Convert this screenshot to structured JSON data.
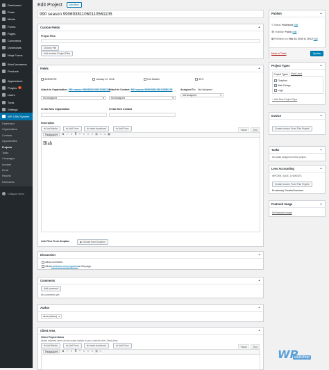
{
  "sidebar": {
    "items": [
      {
        "label": "Dashboard",
        "icon": "dashboard-icon"
      },
      {
        "label": "Posts",
        "icon": "pin-icon"
      },
      {
        "label": "Media",
        "icon": "media-icon"
      },
      {
        "label": "Forms",
        "icon": "forms-icon"
      },
      {
        "label": "Pages",
        "icon": "pages-icon"
      },
      {
        "label": "Comments",
        "icon": "comments-icon"
      },
      {
        "label": "Downloads",
        "icon": "download-icon"
      },
      {
        "label": "Ninja Forms",
        "icon": "ninja-forms-icon"
      },
      {
        "label": "WooCommerce",
        "icon": "woocommerce-icon"
      },
      {
        "label": "Products",
        "icon": "products-icon"
      },
      {
        "label": "Appearance",
        "icon": "appearance-icon"
      },
      {
        "label": "Plugins",
        "icon": "plugins-icon",
        "badge": "1"
      },
      {
        "label": "Users",
        "icon": "users-icon"
      },
      {
        "label": "Tools",
        "icon": "tools-icon"
      },
      {
        "label": "Settings",
        "icon": "settings-icon"
      },
      {
        "label": "WP-CRM System",
        "icon": "crm-icon"
      }
    ],
    "submenu": [
      "Dashboard",
      "Organizations",
      "Contacts",
      "Opportunities",
      "Projects",
      "Tasks",
      "Campaigns",
      "Invoices",
      "Email",
      "Reports",
      "Extensions"
    ],
    "collapse": "Collapse menu"
  },
  "header": {
    "title": "Edit Project",
    "add_new": "Add New"
  },
  "post_title": "990 season 990693811060110561105",
  "custom_fields": {
    "heading": "Custom Fields",
    "project_files_label": "Project Files",
    "choose_file": "Choose File",
    "add_another": "Add another Project Files"
  },
  "fields": {
    "heading": "Fields",
    "value": "843906799",
    "date": "January 12, 2018",
    "status": "Not Started",
    "progress": "40%",
    "attach_org_label": "Attach to Organization:",
    "attach_org_link": "990 season 990693811060110561105",
    "attach_contact_label": "Attach to Contact:",
    "attach_contact_link": "990 season 990693811060110561105",
    "assigned_label": "Assigned To:",
    "assigned_value": "Not Assigned",
    "select_org": "Not Assigned",
    "select_contact": "Not Assigned",
    "assigned_select": "Not Assigned",
    "create_org": "Create New Organization",
    "create_contact": "Create New Contact",
    "description": "Description",
    "add_media": "Add Media",
    "add_form": "Add Form",
    "insert_download": "Insert download",
    "add_form2": "Add Form",
    "visual": "Visual",
    "text": "Text",
    "paragraph": "Paragraph",
    "content": "Blah",
    "link_files": "Link Files From Dropbox",
    "choose_dropbox": "Choose from Dropbox"
  },
  "discussion": {
    "heading": "Discussion",
    "allow_comments": "Allow comments.",
    "allow_trackbacks_pre": "Allow ",
    "allow_trackbacks_link": "trackbacks and pingbacks",
    "allow_trackbacks_post": " on this page."
  },
  "comments": {
    "heading": "Comments",
    "add": "Add comment",
    "none": "No comments yet."
  },
  "author": {
    "heading": "Author",
    "value": "demo (demo)"
  },
  "client_area": {
    "heading": "Client Area",
    "notes_label": "Client Project Notes",
    "notes_desc": "Notes entered here can be made visible to your client in the Client Area.",
    "add_media": "Add Media",
    "add_form": "Add Form",
    "insert_download": "Insert download",
    "add_form2": "Add Form",
    "visual": "Visual",
    "text": "Text"
  },
  "publish": {
    "heading": "Publish",
    "status_label": "Status:",
    "status_value": "Published",
    "status_edit": "Edit",
    "visibility_label": "Visibility:",
    "visibility_value": "Public",
    "visibility_edit": "Edit",
    "published_label": "Published on:",
    "published_value": "Mar 23, 2019 @ 19:12",
    "published_edit": "Edit",
    "trash": "Move to Trash",
    "update": "Update"
  },
  "project_types": {
    "heading": "Project Types",
    "tab_all": "Project Types",
    "tab_most": "Most Used",
    "items": [
      {
        "label": "Graphics",
        "checked": true
      },
      {
        "label": "Web Design",
        "checked": true
      },
      {
        "label": "Logo",
        "checked": false
      }
    ],
    "add": "+ Add New Project Type"
  },
  "invoice": {
    "heading": "Invoice",
    "button": "Create Invoice From This Project"
  },
  "tasks": {
    "heading": "Tasks",
    "none": "No tasks assigned to this project."
  },
  "less_accounting": {
    "heading": "Less Accounting",
    "note": "WPCRM_SAVE_CHANGES",
    "button": "Create Invoice From This Project",
    "previously": "Previously Created Invoices"
  },
  "featured_image": {
    "heading": "Featured Image",
    "set": "Set featured image"
  },
  "colors": {
    "sidebar": "#23282d",
    "accent": "#0073aa",
    "primary_button": "#0085ba",
    "trash": "#a00"
  }
}
